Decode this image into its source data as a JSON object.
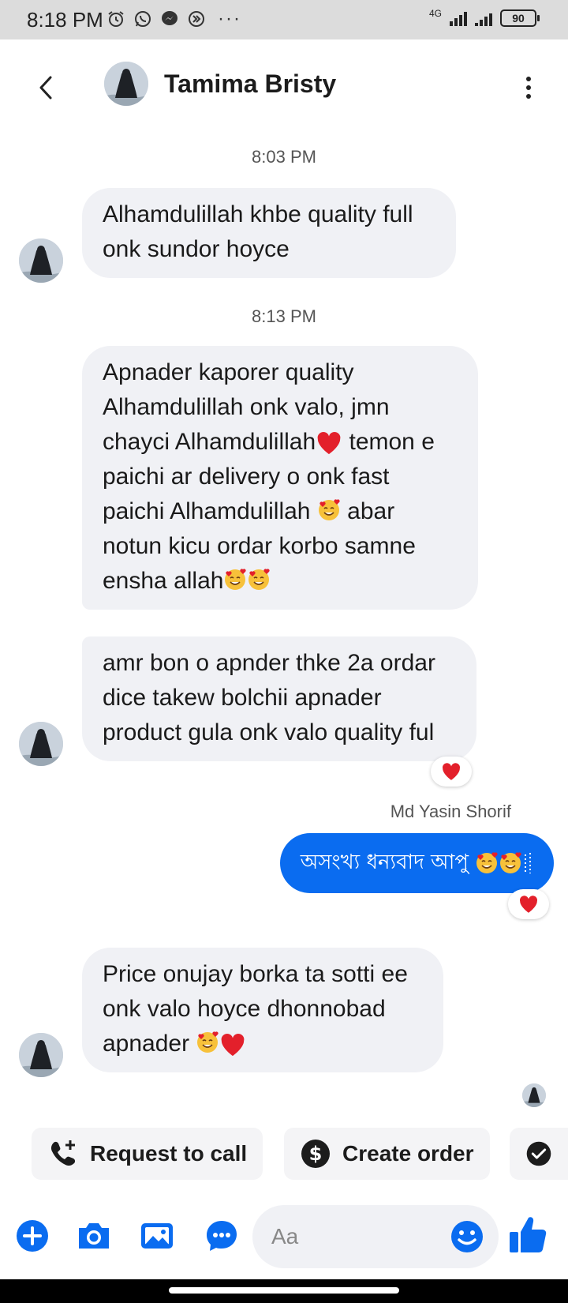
{
  "status_bar": {
    "time": "8:18 PM",
    "network": "4G",
    "battery": "90",
    "more": "···"
  },
  "header": {
    "contact_name": "Tamima Bristy"
  },
  "messages": [
    {
      "timestamp": "8:03 PM"
    },
    {
      "line1": "Alhamdulillah khbe quality full",
      "line2": "onk sundor hoyce"
    },
    {
      "timestamp": "8:13 PM"
    },
    {
      "line1": "Apnader kaporer quality",
      "line2": "Alhamdulillah onk valo, jmn",
      "line3a": "chayci Alhamdulillah",
      "line3b": " temon e",
      "line4": "paichi ar delivery o onk fast",
      "line5a": "paichi Alhamdulillah ",
      "line5b": " abar",
      "line6": "notun kicu ordar korbo samne",
      "line7": "ensha allah"
    },
    {
      "line1": "amr bon o apnder thke 2a ordar",
      "line2": "dice takew bolchii apnader",
      "line3": "product gula onk valo quality ful",
      "reaction": "heart"
    },
    {
      "sender": "Md Yasin Shorif",
      "text": "অসংখ্য ধন্যবাদ আপু",
      "reaction": "heart"
    },
    {
      "line1": "Price onujay borka ta sotti ee",
      "line2": "onk valo hoyce  dhonnobad",
      "line3": "apnader "
    }
  ],
  "quick_actions": [
    {
      "label": "Request to call",
      "icon": "phone-plus-icon"
    },
    {
      "label": "Create order",
      "icon": "dollar-icon"
    },
    {
      "label": "",
      "icon": "check-circle-icon"
    }
  ],
  "composer": {
    "placeholder": "Aa"
  },
  "colors": {
    "accent": "#0a6cf0",
    "bubble_in": "#f0f1f5",
    "heart": "#e3202b"
  }
}
